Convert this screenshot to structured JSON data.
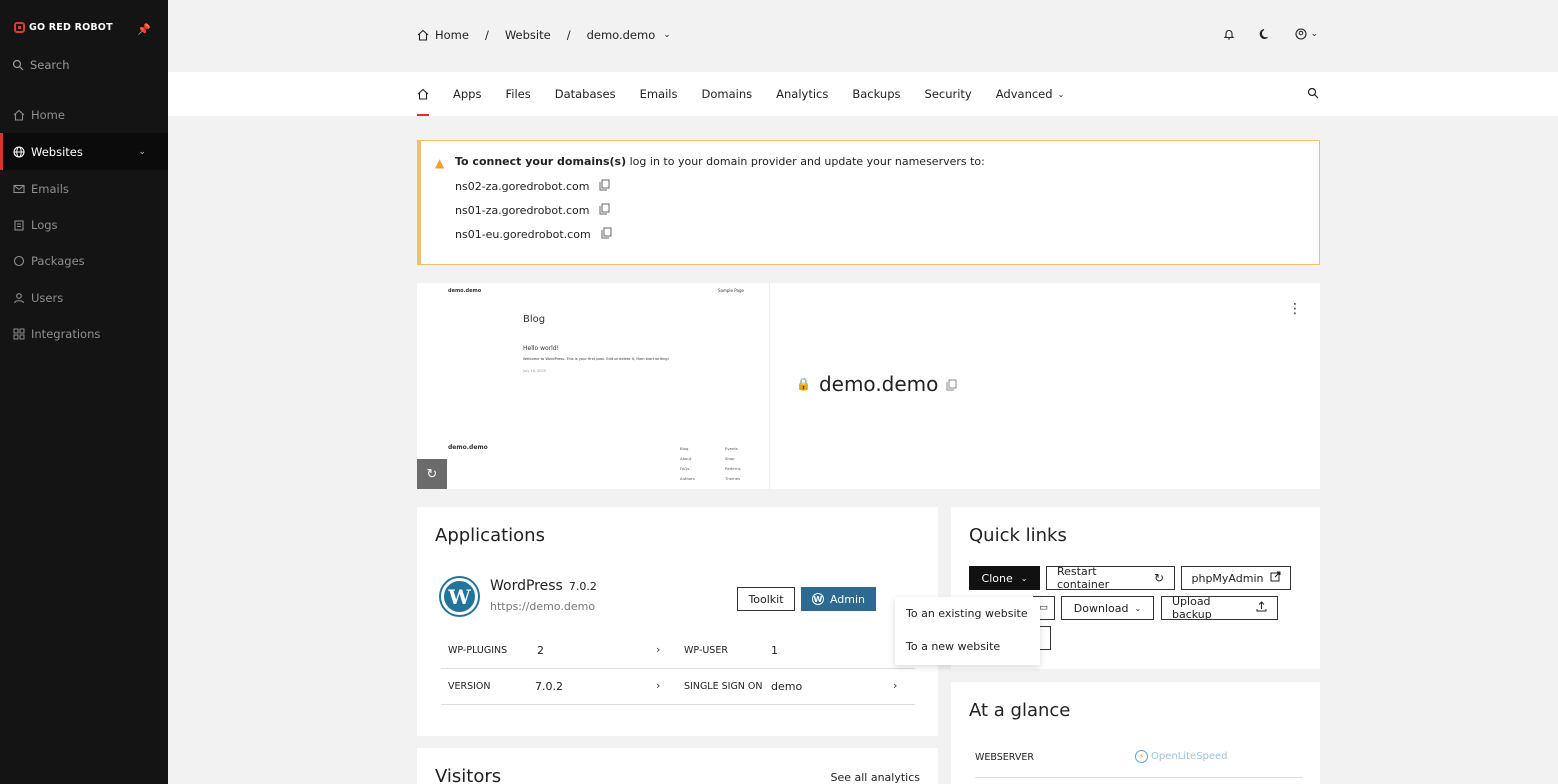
{
  "sidebar": {
    "brand": "GO RED ROBOT",
    "search_placeholder": "Search",
    "items": [
      {
        "label": "Home"
      },
      {
        "label": "Websites"
      },
      {
        "label": "Emails"
      },
      {
        "label": "Logs"
      },
      {
        "label": "Packages"
      },
      {
        "label": "Users"
      },
      {
        "label": "Integrations"
      }
    ]
  },
  "breadcrumb": {
    "home": "Home",
    "section": "Website",
    "current": "demo.demo"
  },
  "tabs": [
    "Apps",
    "Files",
    "Databases",
    "Emails",
    "Domains",
    "Analytics",
    "Backups",
    "Security",
    "Advanced"
  ],
  "alert": {
    "bold": "To connect your domains(s)",
    "text": " log in to your domain provider and update your nameservers to:",
    "nameservers": [
      "ns02-za.goredrobot.com",
      "ns01-za.goredrobot.com",
      "ns01-eu.goredrobot.com"
    ]
  },
  "preview": {
    "site_name_top": "demo.demo",
    "sample_page": "Sample Page",
    "blog": "Blog",
    "post_title": "Hello world!",
    "post_excerpt": "Welcome to WordPress. This is your first post. Edit or delete it, then start writing!",
    "post_date": "July 16, 2025",
    "footer_site": "demo.demo",
    "footer_col1": [
      "Blog",
      "About",
      "FAQs",
      "Authors"
    ],
    "footer_col2": [
      "Events",
      "Shop",
      "Patterns",
      "Themes"
    ]
  },
  "site": {
    "domain": "demo.demo"
  },
  "applications": {
    "title": "Applications",
    "app_name": "WordPress",
    "app_version": "7.0.2",
    "app_url": "https://demo.demo",
    "toolkit_label": "Toolkit",
    "admin_label": "Admin",
    "rows": [
      {
        "k1": "WP-PLUGINS",
        "v1": "2",
        "k2": "WP-USER",
        "v2": "1"
      },
      {
        "k1": "VERSION",
        "v1": "7.0.2",
        "k2": "SINGLE SIGN ON",
        "v2": "demo"
      }
    ]
  },
  "visitors": {
    "title": "Visitors",
    "link": "See all analytics"
  },
  "quick_links": {
    "title": "Quick links",
    "clone": "Clone",
    "restart": "Restart container",
    "phpmyadmin": "phpMyAdmin",
    "download": "Download",
    "upload_backup": "Upload backup"
  },
  "clone_menu": {
    "items": [
      "To an existing website",
      "To a new website"
    ]
  },
  "glance": {
    "title": "At a glance",
    "webserver_label": "WEBSERVER",
    "webserver_value": "OpenLiteSpeed"
  },
  "colors": {
    "accent": "#d8342a",
    "sidebar_bg": "#141414",
    "admin_button": "#2c6a92",
    "alert_border": "#f2c06a"
  }
}
